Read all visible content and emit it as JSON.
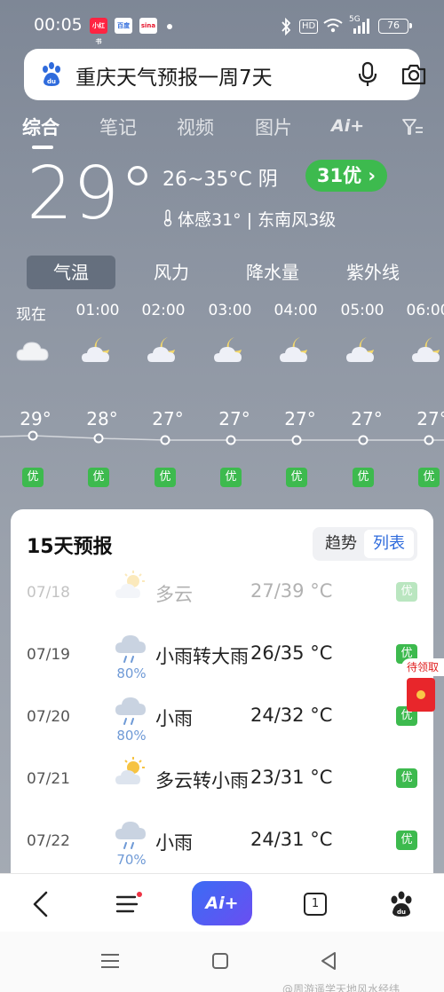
{
  "status_bar": {
    "time": "00:05",
    "app_badges": [
      {
        "text": "小红书",
        "color": "#ff2442"
      },
      {
        "text": "百度",
        "color": "#2f6bdc"
      },
      {
        "text": "sina",
        "color": "#e6162d"
      }
    ],
    "hd_label": "HD",
    "signal_label": "5G",
    "battery": "76"
  },
  "search": {
    "query": "重庆天气预报一周7天"
  },
  "tabs": {
    "items": [
      "综合",
      "笔记",
      "视频",
      "图片"
    ],
    "ai_label": "Ai+"
  },
  "current": {
    "temp": "29°",
    "range_condition": "26~35°C  阴",
    "aqi_label": "31优 ›",
    "feels_wind": "体感31° | 东南风3级"
  },
  "metric_tabs": [
    "气温",
    "风力",
    "降水量",
    "紫外线"
  ],
  "hourly": [
    {
      "time": "现在",
      "temp": "29°",
      "aqi": "优",
      "icon": "cloud-icon"
    },
    {
      "time": "01:00",
      "temp": "28°",
      "aqi": "优",
      "icon": "moon-cloud-icon"
    },
    {
      "time": "02:00",
      "temp": "27°",
      "aqi": "优",
      "icon": "moon-cloud-icon"
    },
    {
      "time": "03:00",
      "temp": "27°",
      "aqi": "优",
      "icon": "moon-cloud-icon"
    },
    {
      "time": "04:00",
      "temp": "27°",
      "aqi": "优",
      "icon": "moon-cloud-icon"
    },
    {
      "time": "05:00",
      "temp": "27°",
      "aqi": "优",
      "icon": "moon-cloud-icon"
    },
    {
      "time": "06:00",
      "temp": "27°",
      "aqi": "优",
      "icon": "moon-cloud-icon"
    }
  ],
  "forecast": {
    "title": "15天预报",
    "toggle_trend": "趋势",
    "toggle_list": "列表",
    "rows": [
      {
        "date": "07/18",
        "icon": "sun-cloud-icon",
        "prob": "",
        "condition": "多云",
        "temp": "27/39 °C",
        "aqi": "优"
      },
      {
        "date": "07/19",
        "icon": "rain-cloud-icon",
        "prob": "80%",
        "condition": "小雨转大雨",
        "temp": "26/35 °C",
        "aqi": "优"
      },
      {
        "date": "07/20",
        "icon": "rain-cloud-icon",
        "prob": "80%",
        "condition": "小雨",
        "temp": "24/32 °C",
        "aqi": "优"
      },
      {
        "date": "07/21",
        "icon": "sun-cloud-icon",
        "prob": "",
        "condition": "多云转小雨",
        "temp": "23/31 °C",
        "aqi": "优"
      },
      {
        "date": "07/22",
        "icon": "rain-cloud-icon",
        "prob": "70%",
        "condition": "小雨",
        "temp": "24/31 °C",
        "aqi": "优"
      }
    ]
  },
  "red_packet": {
    "label": "待领取"
  },
  "bottom_nav": {
    "ai_label": "Ai+",
    "tab_count": "1"
  },
  "watermark": "@周游遥学天地风水经纬"
}
